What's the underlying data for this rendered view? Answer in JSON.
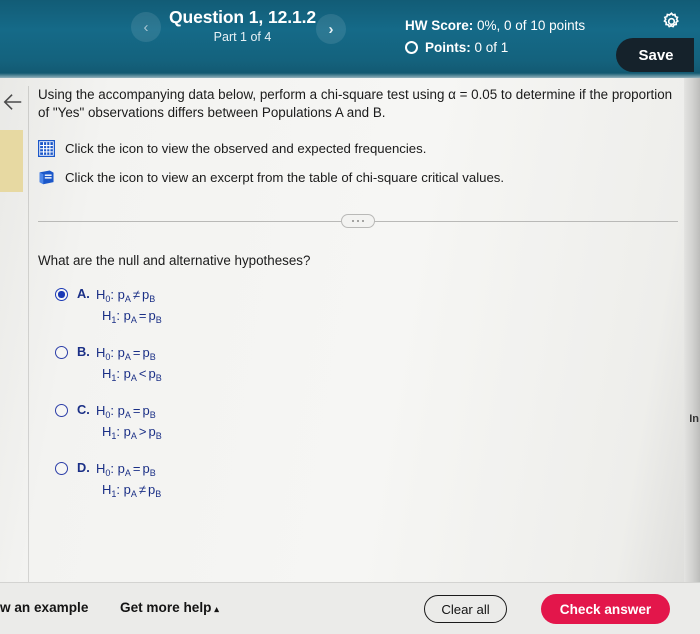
{
  "header": {
    "question_title": "Question 1, 12.1.2",
    "part_label": "Part 1 of 4",
    "prev_icon": "chevron-left-icon",
    "next_icon": "chevron-right-icon",
    "hw_score_label": "HW Score:",
    "hw_score_value": "0%, 0 of 10 points",
    "points_label": "Points:",
    "points_value": "0 of 1",
    "gear_icon": "gear-icon",
    "save_label": "Save",
    "bg_color": "#14627d",
    "save_bg_color": "#15222b"
  },
  "rail": {
    "back_icon": "arrow-left-icon",
    "highlight_color": "#e7d9a2",
    "clipped_text": "In"
  },
  "body": {
    "prompt": "Using the accompanying data below, perform a chi-square test using α = 0.05 to determine if the proportion of \"Yes\" observations differs between Populations A and B.",
    "resources": [
      {
        "icon": "table-grid-icon",
        "label": "Click the icon to view the observed and expected frequencies."
      },
      {
        "icon": "book-icon",
        "label": "Click the icon to view an excerpt from the table of chi-square critical values."
      }
    ],
    "divider_dots": "...",
    "sub_question": "What are the null and alternative hypotheses?",
    "accent_color": "#1a39b5"
  },
  "choices": [
    {
      "letter": "A.",
      "selected": true,
      "lines": [
        {
          "h": "H",
          "hsub": "0",
          "left": "p",
          "leftsub": "A",
          "op": "≠",
          "right": "p",
          "rightsub": "B"
        },
        {
          "h": "H",
          "hsub": "1",
          "left": "p",
          "leftsub": "A",
          "op": "=",
          "right": "p",
          "rightsub": "B"
        }
      ]
    },
    {
      "letter": "B.",
      "selected": false,
      "lines": [
        {
          "h": "H",
          "hsub": "0",
          "left": "p",
          "leftsub": "A",
          "op": "=",
          "right": "p",
          "rightsub": "B"
        },
        {
          "h": "H",
          "hsub": "1",
          "left": "p",
          "leftsub": "A",
          "op": "<",
          "right": "p",
          "rightsub": "B"
        }
      ]
    },
    {
      "letter": "C.",
      "selected": false,
      "lines": [
        {
          "h": "H",
          "hsub": "0",
          "left": "p",
          "leftsub": "A",
          "op": "=",
          "right": "p",
          "rightsub": "B"
        },
        {
          "h": "H",
          "hsub": "1",
          "left": "p",
          "leftsub": "A",
          "op": ">",
          "right": "p",
          "rightsub": "B"
        }
      ]
    },
    {
      "letter": "D.",
      "selected": false,
      "lines": [
        {
          "h": "H",
          "hsub": "0",
          "left": "p",
          "leftsub": "A",
          "op": "=",
          "right": "p",
          "rightsub": "B"
        },
        {
          "h": "H",
          "hsub": "1",
          "left": "p",
          "leftsub": "A",
          "op": "≠",
          "right": "p",
          "rightsub": "B"
        }
      ]
    }
  ],
  "footer": {
    "view_example_label": "w an example",
    "get_more_help_label": "Get more help",
    "get_more_help_caret": "▴",
    "clear_all_label": "Clear all",
    "check_answer_label": "Check answer",
    "check_answer_color": "#e3164b"
  }
}
